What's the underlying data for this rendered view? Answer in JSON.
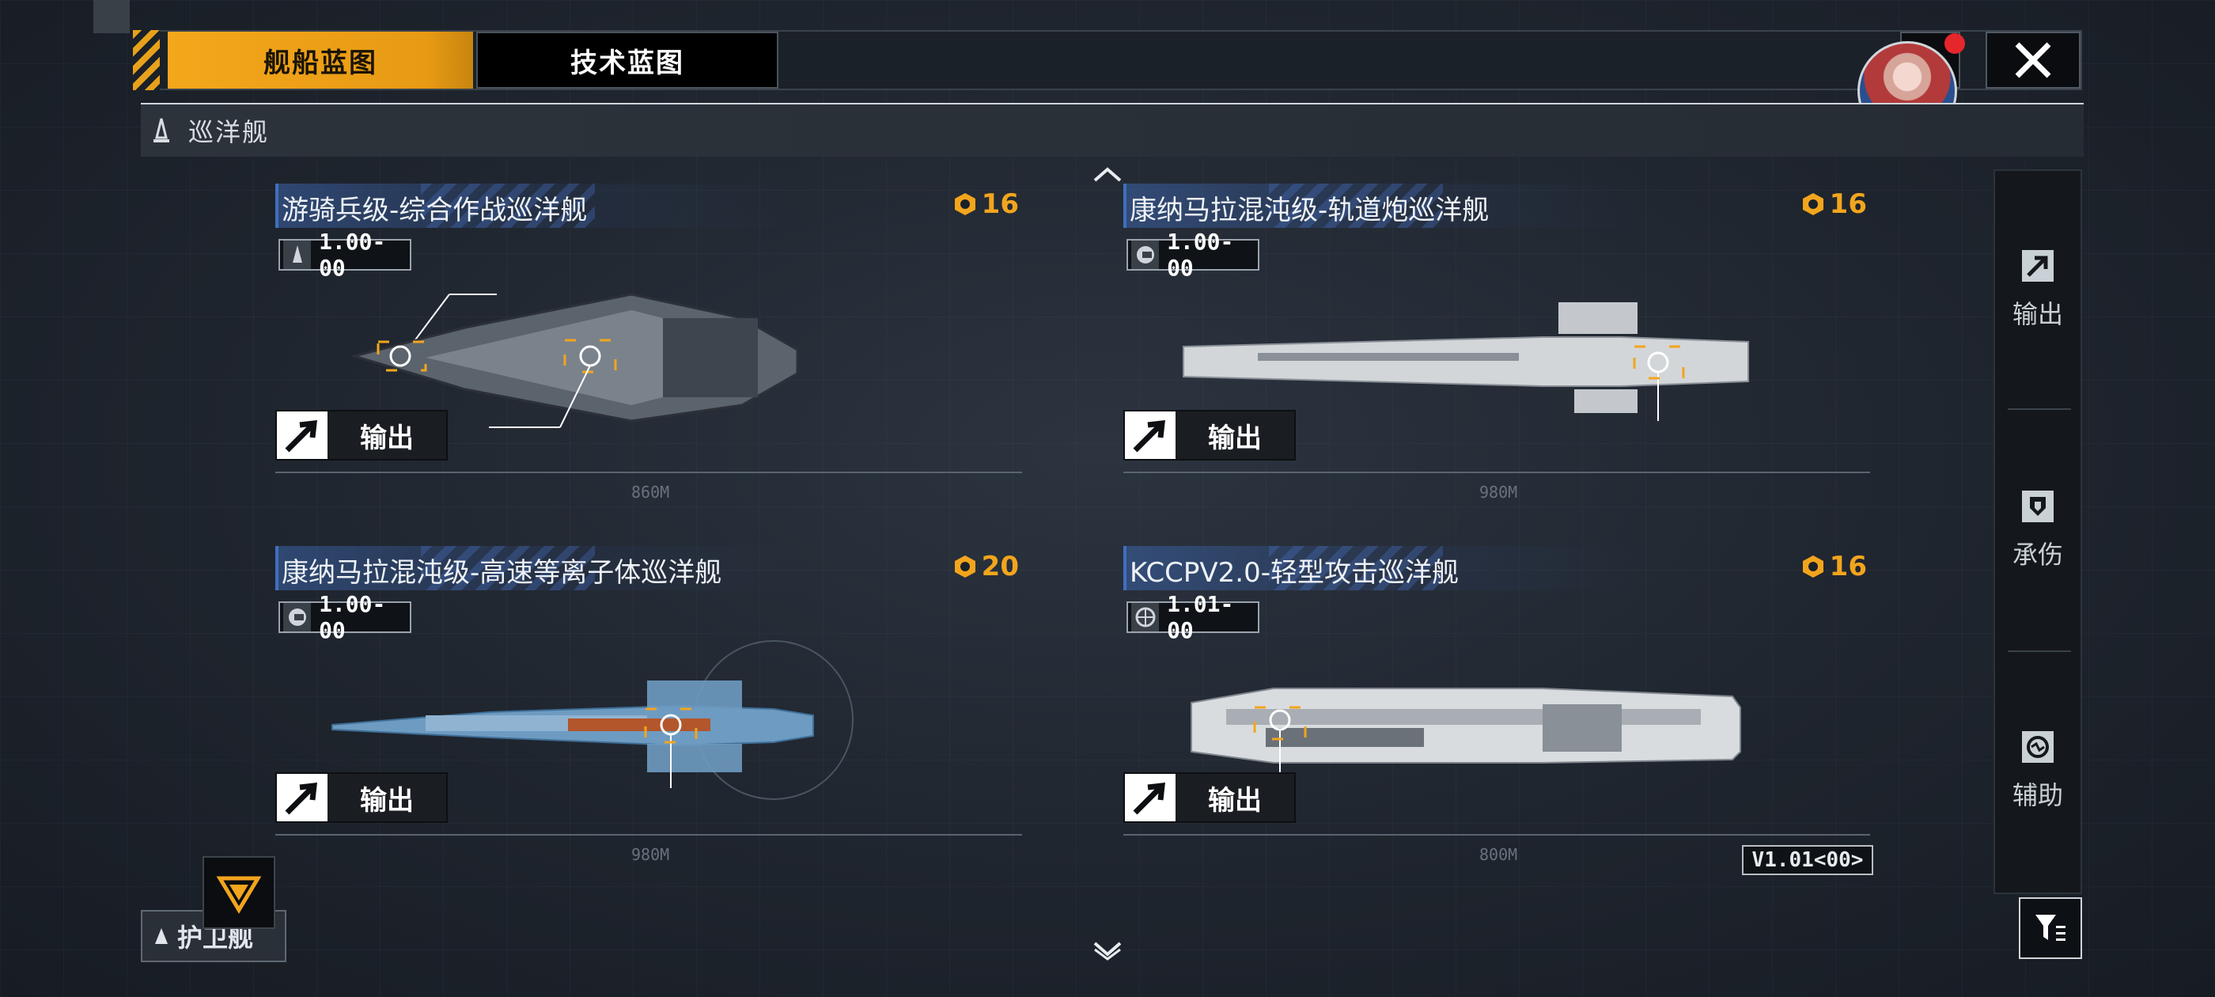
{
  "tabs": [
    {
      "label": "舰船蓝图",
      "active": true
    },
    {
      "label": "技术蓝图",
      "active": false
    }
  ],
  "category": {
    "label": "巡洋舰",
    "icon": "ship-class-icon"
  },
  "sidebar": {
    "items": [
      {
        "label": "输出",
        "icon": "arrow-output-icon"
      },
      {
        "label": "承伤",
        "icon": "shield-icon"
      },
      {
        "label": "辅助",
        "icon": "support-icon"
      }
    ]
  },
  "cards": [
    {
      "title": "游骑兵级-综合作战巡洋舰",
      "cost": "16",
      "version": "1.00-00",
      "export_label": "输出",
      "scale": "860M"
    },
    {
      "title": "康纳马拉混沌级-轨道炮巡洋舰",
      "cost": "16",
      "version": "1.00-00",
      "export_label": "输出",
      "scale": "980M"
    },
    {
      "title": "康纳马拉混沌级-高速等离子体巡洋舰",
      "cost": "20",
      "version": "1.00-00",
      "export_label": "输出",
      "scale": "980M"
    },
    {
      "title": "KCCPV2.0-轻型攻击巡洋舰",
      "cost": "16",
      "version": "1.01-00",
      "export_label": "输出",
      "scale": "800M"
    }
  ],
  "version_tag": "V1.01<00>",
  "escort": {
    "label": "护卫舰"
  },
  "colors": {
    "accent": "#f2a51d",
    "title_blue": "#3f6fbf",
    "panel": "#14181d"
  }
}
